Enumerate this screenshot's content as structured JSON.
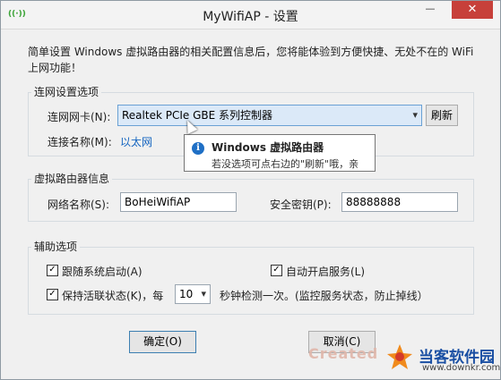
{
  "window": {
    "title": "MyWifiAP - 设置",
    "minimize": "—",
    "close": "✕",
    "app_icon": "((·))"
  },
  "intro": "简单设置 Windows 虚拟路由器的相关配置信息后，您将能体验到方便快捷、无处不在的 WiFi 上网功能！",
  "network": {
    "group_title": "连网设置选项",
    "adapter_label": "连网网卡(N):",
    "adapter_value": "Realtek PCIe GBE 系列控制器",
    "refresh_button": "刷新",
    "connection_label": "连接名称(M):",
    "connection_value": "以太网"
  },
  "tooltip": {
    "icon": "i",
    "title": "Windows 虚拟路由器",
    "text": "若没选项可点右边的\"刷新\"哦，亲"
  },
  "router": {
    "group_title": "虚拟路由器信息",
    "ssid_label": "网络名称(S):",
    "ssid_value": "BoHeiWifiAP",
    "key_label": "安全密钥(P):",
    "key_value": "88888888"
  },
  "aux": {
    "group_title": "辅助选项",
    "autostart_label": "跟随系统启动(A)",
    "autostart_checked": true,
    "autoservice_label": "自动开启服务(L)",
    "autoservice_checked": true,
    "keepalive_label": "保持活联状态(K)，每",
    "keepalive_checked": true,
    "interval_value": "10",
    "interval_suffix": "秒钟检测一次。(监控服务状态，防止掉线）"
  },
  "buttons": {
    "ok": "确定(O)",
    "cancel": "取消(C)"
  },
  "watermark": {
    "created": "Created",
    "brand": "当客软件园",
    "url": "www.downkr.com"
  },
  "colors": {
    "close_bg": "#c7403a",
    "link": "#1565c0",
    "tooltip_icon": "#1f6fc5"
  }
}
